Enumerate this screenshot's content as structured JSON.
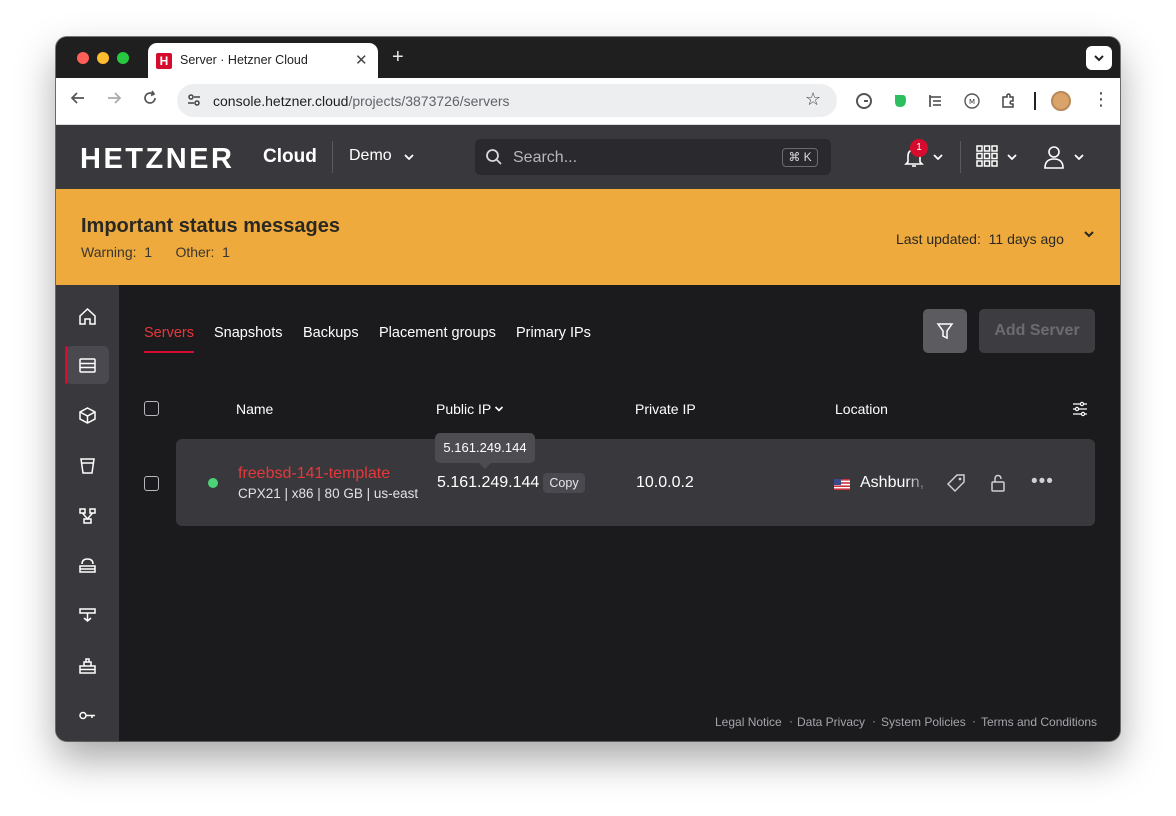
{
  "browser": {
    "tab_title": "Server · Hetzner Cloud",
    "favicon_letter": "H",
    "url_host": "console.hetzner.cloud",
    "url_path": "/projects/3873726/servers",
    "new_tab": "+",
    "close_tab": "✕"
  },
  "header": {
    "logo": "HETZNER",
    "product": "Cloud",
    "project": "Demo",
    "search_placeholder": "Search...",
    "search_shortcut": "⌘ K",
    "notification_count": "1"
  },
  "banner": {
    "title": "Important status messages",
    "warning_label": "Warning:",
    "warning_count": "1",
    "other_label": "Other:",
    "other_count": "1",
    "updated_label": "Last updated:",
    "updated_value": "11 days ago"
  },
  "sidebar": {
    "items": [
      "home",
      "servers",
      "volumes",
      "buckets",
      "networks",
      "load-balancers",
      "firewalls",
      "floating-ips",
      "security"
    ],
    "active": "servers"
  },
  "tabs": [
    "Servers",
    "Snapshots",
    "Backups",
    "Placement groups",
    "Primary IPs"
  ],
  "actions": {
    "add_server": "Add Server"
  },
  "table": {
    "columns": [
      "Name",
      "Public IP",
      "Private IP",
      "Location"
    ],
    "rows": [
      {
        "name": "freebsd-141-template",
        "spec": "CPX21 | x86 | 80 GB | us-east",
        "public_ip": "5.161.249.144",
        "copy_label": "Copy",
        "private_ip": "10.0.0.2",
        "location": "Ashburn, VA",
        "status": "running"
      }
    ],
    "tooltip": "5.161.249.144"
  },
  "footer": {
    "links": [
      "Legal Notice",
      "Data Privacy",
      "System Policies",
      "Terms and Conditions"
    ]
  },
  "colors": {
    "brand_red": "#d50c2d",
    "banner": "#eeaa3c",
    "status_green": "#4ad477"
  }
}
